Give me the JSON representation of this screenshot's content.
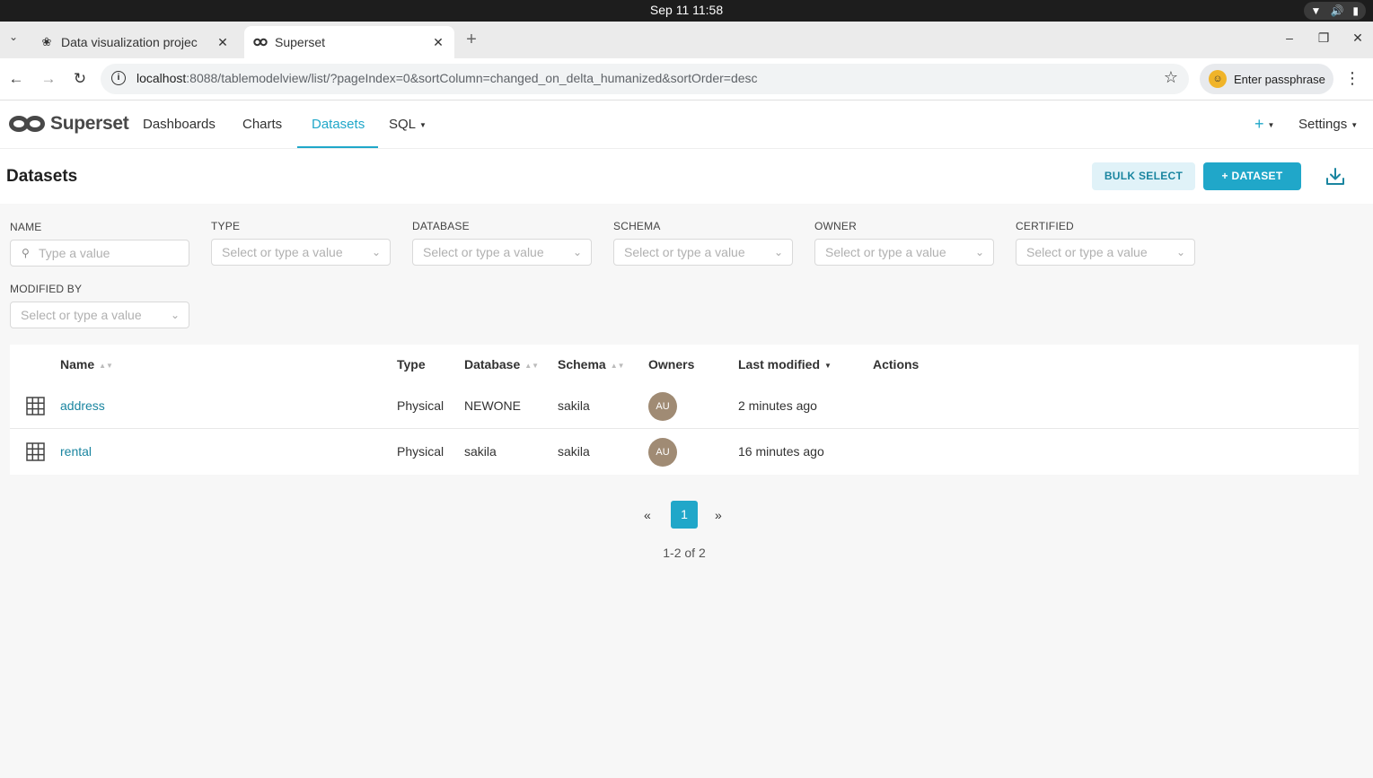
{
  "os": {
    "clock": "Sep 11  11:58"
  },
  "browser": {
    "tabs": [
      {
        "title": "Data visualization projec",
        "favicon": "openai-icon"
      },
      {
        "title": "Superset",
        "favicon": "superset-icon"
      }
    ],
    "url_host": "localhost",
    "url_rest": ":8088/tablemodelview/list/?pageIndex=0&sortColumn=changed_on_delta_humanized&sortOrder=desc",
    "profile_label": "Enter passphrase"
  },
  "nav": {
    "logo_text": "Superset",
    "items": [
      {
        "label": "Dashboards"
      },
      {
        "label": "Charts"
      },
      {
        "label": "Datasets"
      },
      {
        "label": "SQL"
      }
    ],
    "plus": "+",
    "settings": "Settings"
  },
  "header": {
    "title": "Datasets",
    "bulk_select": "BULK SELECT",
    "add_dataset": "+  DATASET"
  },
  "filters": [
    {
      "label": "NAME",
      "placeholder": "Type a value"
    },
    {
      "label": "TYPE",
      "placeholder": "Select or type a value"
    },
    {
      "label": "DATABASE",
      "placeholder": "Select or type a value"
    },
    {
      "label": "SCHEMA",
      "placeholder": "Select or type a value"
    },
    {
      "label": "OWNER",
      "placeholder": "Select or type a value"
    },
    {
      "label": "CERTIFIED",
      "placeholder": "Select or type a value"
    },
    {
      "label": "MODIFIED BY",
      "placeholder": "Select or type a value"
    }
  ],
  "table": {
    "columns": [
      "Name",
      "Type",
      "Database",
      "Schema",
      "Owners",
      "Last modified",
      "Actions"
    ],
    "rows": [
      {
        "name": "address",
        "type": "Physical",
        "database": "NEWONE",
        "schema": "sakila",
        "owner": "AU",
        "modified": "2 minutes ago"
      },
      {
        "name": "rental",
        "type": "Physical",
        "database": "sakila",
        "schema": "sakila",
        "owner": "AU",
        "modified": "16 minutes ago"
      }
    ]
  },
  "pagination": {
    "prev": "«",
    "current": "1",
    "next": "»",
    "info": "1-2 of 2"
  },
  "colors": {
    "accent": "#20a7c9",
    "link": "#1a85a0",
    "owner_avatar": "#a08b74"
  }
}
